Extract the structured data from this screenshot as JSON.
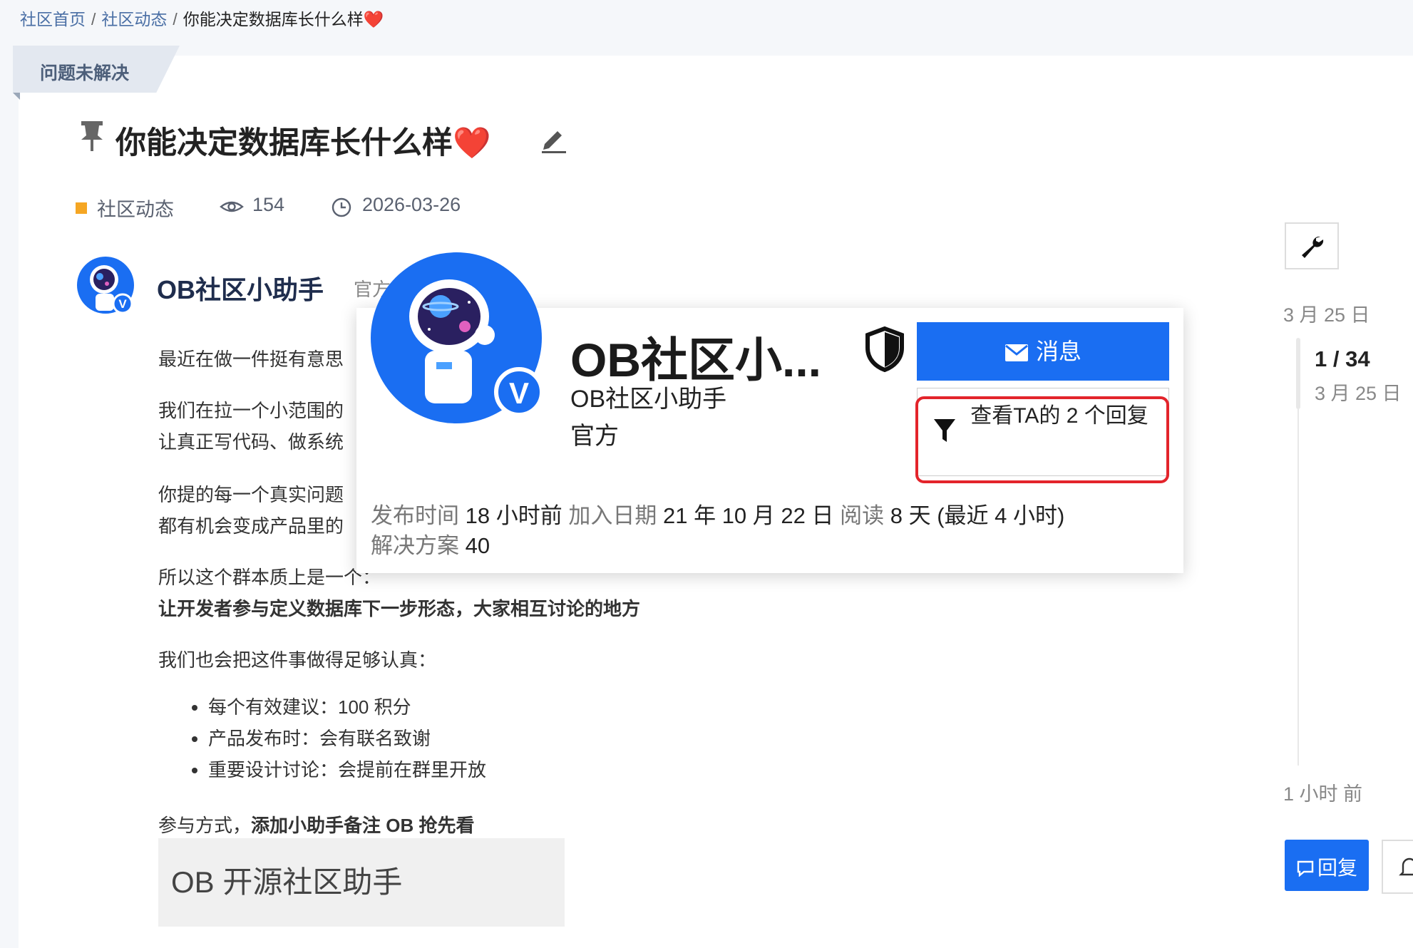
{
  "breadcrumb": {
    "home": "社区首页",
    "sep": "/",
    "category": "社区动态",
    "current": "你能决定数据库长什么样"
  },
  "status_ribbon": "问题未解决",
  "topic": {
    "title": "你能决定数据库长什么样",
    "category": "社区动态",
    "views": "154",
    "date": "2026-03-26"
  },
  "author": {
    "name": "OB社区小助手",
    "badge": "官方"
  },
  "body": {
    "p1": "最近在做一件挺有意思",
    "p2a": "我们在拉一个小范围的",
    "p2b": "让真正写代码、做系统",
    "p3a": "你提的每一个真实问题",
    "p3b": "都有机会变成产品里的",
    "p4": "所以这个群本质上是一",
    "p4_tail": "个：",
    "p5": "让开发者参与定义数据库下一步形态，大家相互讨论的地方",
    "p6": "我们也会把这件事做得足够认真：",
    "list": [
      "每个有效建议：100 积分",
      "产品发布时：会有联名致谢",
      "重要设计讨论：会提前在群里开放"
    ],
    "p7_prefix": "参与方式，",
    "p7_bold": "添加小助手备注 OB 抢先看",
    "image_text": "OB 开源社区助手"
  },
  "timeline": {
    "start_date": "3 月 25 日",
    "position": "1 / 34",
    "position_date": "3 月 25 日",
    "last_activity": "1 小时 前",
    "reply_label": "回复"
  },
  "user_card": {
    "name": "OB社区小...",
    "username": "OB社区小助手",
    "role": "官方",
    "message_label": "消息",
    "filter_label": "查看TA的 2 个回复",
    "stats": {
      "posted_label": "发布时间",
      "posted_value": "18 小时前",
      "joined_label": "加入日期",
      "joined_value": "21 年 10 月 22 日",
      "read_label": "阅读",
      "read_value": "8 天 (最近 4 小时)",
      "solutions_label": "解决方案",
      "solutions_value": "40"
    }
  },
  "colors": {
    "primary": "#1a6ef2",
    "highlight": "#e3242b",
    "category": "#f5a623"
  },
  "icons": [
    "pin-icon",
    "edit-icon",
    "eye-icon",
    "clock-icon",
    "wrench-icon",
    "shield-icon",
    "envelope-icon",
    "filter-icon",
    "reply-icon",
    "bell-icon",
    "heart-icon"
  ]
}
